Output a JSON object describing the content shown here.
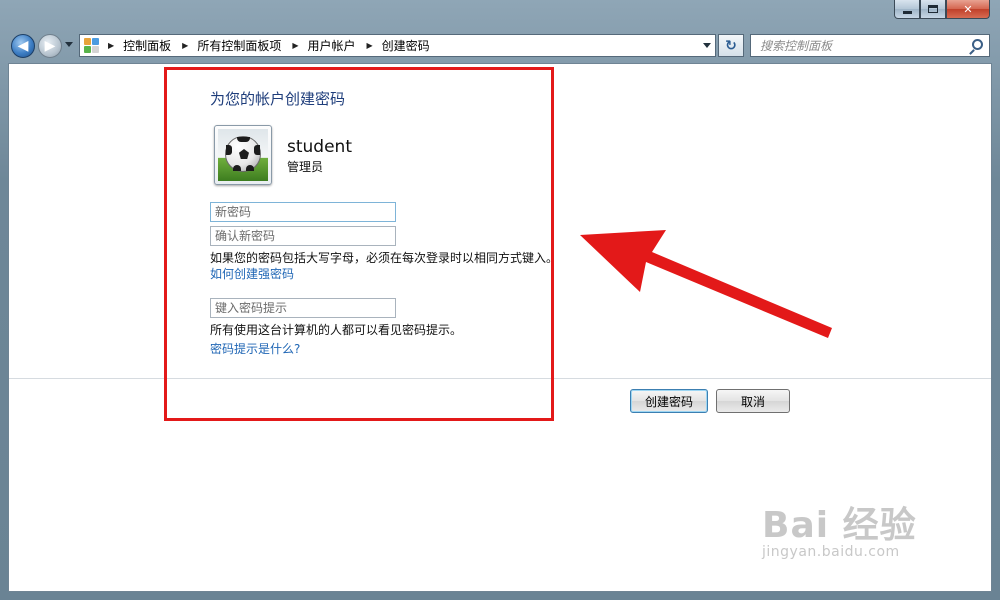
{
  "window": {
    "controls": [
      "minimize",
      "maximize",
      "close"
    ],
    "close_glyph": "✕"
  },
  "navigation": {
    "back_glyph": "◀",
    "forward_glyph": "▶",
    "breadcrumbs": [
      {
        "label": "控制面板"
      },
      {
        "label": "所有控制面板项"
      },
      {
        "label": "用户帐户"
      },
      {
        "label": "创建密码"
      }
    ],
    "refresh_glyph": "↻",
    "search_placeholder": "搜索控制面板"
  },
  "page": {
    "heading": "为您的帐户创建密码",
    "user": {
      "name": "student",
      "role": "管理员",
      "avatar_icon": "soccer-ball-icon"
    },
    "new_password_placeholder": "新密码",
    "confirm_password_placeholder": "确认新密码",
    "case_note": "如果您的密码包括大写字母，必须在每次登录时以相同方式键入。",
    "strong_password_link": "如何创建强密码",
    "hint_placeholder": "键入密码提示",
    "hint_note": "所有使用这台计算机的人都可以看见密码提示。",
    "hint_link": "密码提示是什么?"
  },
  "actions": {
    "create_label": "创建密码",
    "cancel_label": "取消"
  },
  "annotation": {
    "color": "#e31919"
  },
  "watermark": {
    "logo": "Bai 经验",
    "site": "jingyan.baidu.com"
  }
}
